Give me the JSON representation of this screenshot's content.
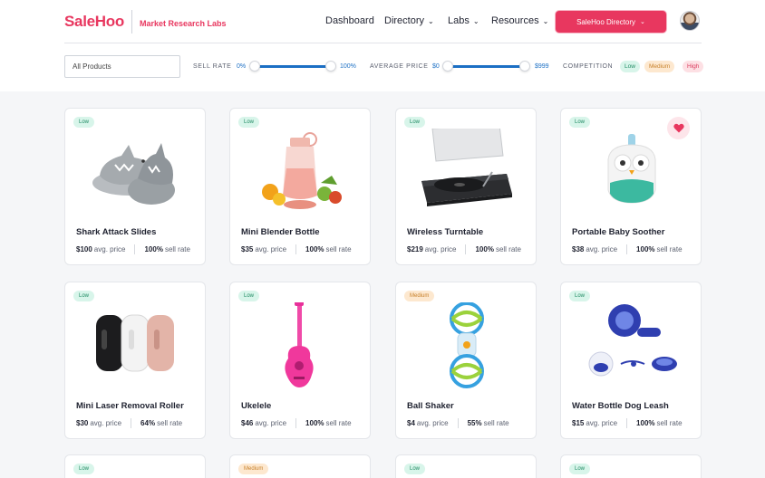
{
  "header": {
    "logo": "SaleHoo",
    "tagline": "Market Research Labs",
    "nav": [
      {
        "label": "Dashboard",
        "has_dropdown": false
      },
      {
        "label": "Directory",
        "has_dropdown": true
      },
      {
        "label": "Labs",
        "has_dropdown": true
      },
      {
        "label": "Resources",
        "has_dropdown": true
      }
    ],
    "directory_button": "SaleHoo Directory",
    "avatar_icon": "user-avatar"
  },
  "filters": {
    "category_select": "All Products",
    "sell_rate": {
      "label": "SELL RATE",
      "min": "0%",
      "max": "100%"
    },
    "average_price": {
      "label": "AVERAGE PRICE",
      "min": "$0",
      "max": "$999"
    },
    "competition": {
      "label": "COMPETITION",
      "options": [
        "Low",
        "Medium",
        "High"
      ]
    }
  },
  "colors": {
    "brand": "#e8375f",
    "slider": "#1b6fc4",
    "low": "#d8f5ea",
    "medium": "#fde8cf",
    "high": "#fde0e4"
  },
  "products": [
    {
      "competition": "Low",
      "title": "Shark Attack Slides",
      "price": "$100",
      "price_label": "avg. price",
      "sell_rate": "100%",
      "sell_rate_label": "sell rate",
      "favorited": false
    },
    {
      "competition": "Low",
      "title": "Mini Blender Bottle",
      "price": "$35",
      "price_label": "avg. price",
      "sell_rate": "100%",
      "sell_rate_label": "sell rate",
      "favorited": false
    },
    {
      "competition": "Low",
      "title": "Wireless Turntable",
      "price": "$219",
      "price_label": "avg. price",
      "sell_rate": "100%",
      "sell_rate_label": "sell rate",
      "favorited": false
    },
    {
      "competition": "Low",
      "title": "Portable Baby Soother",
      "price": "$38",
      "price_label": "avg. price",
      "sell_rate": "100%",
      "sell_rate_label": "sell rate",
      "favorited": true
    },
    {
      "competition": "Low",
      "title": "Mini Laser Removal Roller",
      "price": "$30",
      "price_label": "avg. price",
      "sell_rate": "64%",
      "sell_rate_label": "sell rate",
      "favorited": false
    },
    {
      "competition": "Low",
      "title": "Ukelele",
      "price": "$46",
      "price_label": "avg. price",
      "sell_rate": "100%",
      "sell_rate_label": "sell rate",
      "favorited": false
    },
    {
      "competition": "Medium",
      "title": "Ball Shaker",
      "price": "$4",
      "price_label": "avg. price",
      "sell_rate": "55%",
      "sell_rate_label": "sell rate",
      "favorited": false
    },
    {
      "competition": "Low",
      "title": "Water Bottle Dog Leash",
      "price": "$15",
      "price_label": "avg. price",
      "sell_rate": "100%",
      "sell_rate_label": "sell rate",
      "favorited": false
    }
  ],
  "next_row": [
    {
      "competition": "Low"
    },
    {
      "competition": "Medium"
    },
    {
      "competition": "Low"
    },
    {
      "competition": "Low"
    }
  ]
}
